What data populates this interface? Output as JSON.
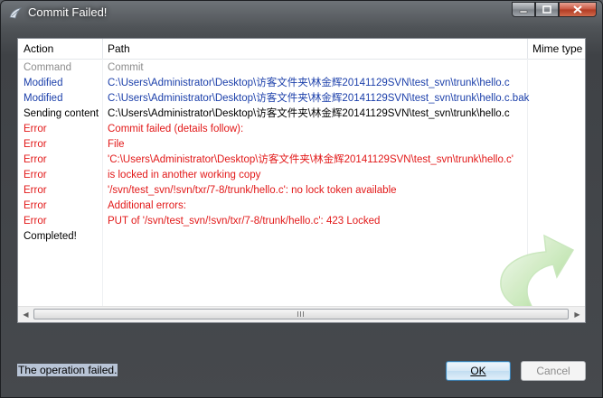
{
  "window": {
    "title": "Commit Failed!"
  },
  "table": {
    "columns": [
      "Action",
      "Path",
      "Mime type"
    ],
    "rows": [
      {
        "action": "Command",
        "path": "Commit",
        "color": "#8c8c8c"
      },
      {
        "action": "Modified",
        "path": "C:\\Users\\Administrator\\Desktop\\访客文件夹\\林金辉20141129SVN\\test_svn\\trunk\\hello.c",
        "color": "#1b3faa"
      },
      {
        "action": "Modified",
        "path": "C:\\Users\\Administrator\\Desktop\\访客文件夹\\林金辉20141129SVN\\test_svn\\trunk\\hello.c.bak",
        "color": "#1b3faa"
      },
      {
        "action": "Sending content",
        "path": "C:\\Users\\Administrator\\Desktop\\访客文件夹\\林金辉20141129SVN\\test_svn\\trunk\\hello.c",
        "color": "#000000"
      },
      {
        "action": "Error",
        "path": "Commit failed (details follow):",
        "color": "#e21818"
      },
      {
        "action": "Error",
        "path": "File",
        "color": "#e21818"
      },
      {
        "action": "Error",
        "path": " 'C:\\Users\\Administrator\\Desktop\\访客文件夹\\林金辉20141129SVN\\test_svn\\trunk\\hello.c'",
        "color": "#e21818"
      },
      {
        "action": "Error",
        "path": " is locked in another working copy",
        "color": "#e21818"
      },
      {
        "action": "Error",
        "path": "'/svn/test_svn/!svn/txr/7-8/trunk/hello.c': no lock token available",
        "color": "#e21818"
      },
      {
        "action": "Error",
        "path": "Additional errors:",
        "color": "#e21818"
      },
      {
        "action": "Error",
        "path": "PUT of '/svn/test_svn/!svn/txr/7-8/trunk/hello.c': 423 Locked",
        "color": "#e21818"
      },
      {
        "action": "Completed!",
        "path": "",
        "color": "#000000"
      }
    ]
  },
  "status": "The operation failed.",
  "buttons": {
    "ok": "OK",
    "cancel": "Cancel"
  },
  "icons": {
    "app": "tortoise-svn-icon",
    "watermark": "curved-arrow-icon"
  }
}
